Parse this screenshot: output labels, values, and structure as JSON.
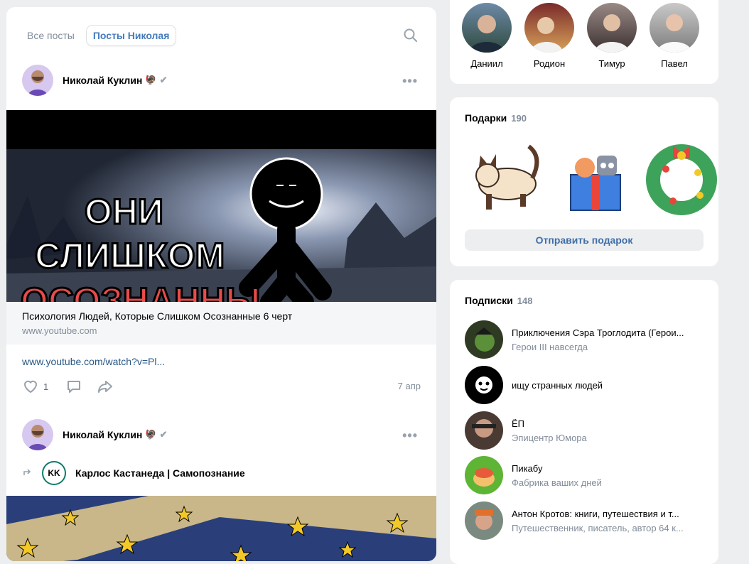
{
  "feed": {
    "tabs": [
      {
        "label": "Все посты"
      },
      {
        "label": "Посты Николая"
      }
    ],
    "posts": [
      {
        "author": "Николай Куклин",
        "emoji": "🦃",
        "link_title": "Психология Людей, Которые Слишком Осознанные 6 черт",
        "link_domain": "www.youtube.com",
        "url_text": "www.youtube.com/watch?v=Pl...",
        "likes": "1",
        "date": "7 апр",
        "thumb_text": [
          "ОНИ",
          "СЛИШКОМ",
          "ОСОЗНАННЫ"
        ]
      },
      {
        "author": "Николай Куклин",
        "emoji": "🦃",
        "repost_group": "Карлос Кастанеда | Самопознание",
        "repost_logo": "KK"
      }
    ]
  },
  "friends": [
    {
      "name": "Даниил"
    },
    {
      "name": "Родион"
    },
    {
      "name": "Тимур"
    },
    {
      "name": "Павел"
    }
  ],
  "gifts": {
    "title": "Подарки",
    "count": "190",
    "send_label": "Отправить подарок"
  },
  "subscriptions": {
    "title": "Подписки",
    "count": "148",
    "items": [
      {
        "name": "Приключения Сэра Троглодита (Герои...",
        "sub": "Герои III навсегда"
      },
      {
        "name": "ищу странных людей",
        "sub": ""
      },
      {
        "name": "ЁП",
        "sub": "Эпицентр Юмора"
      },
      {
        "name": "Пикабу",
        "sub": "Фабрика ваших дней"
      },
      {
        "name": "Антон Кротов: книги, путешествия и т...",
        "sub": "Путешественник, писатель, автор 64 к..."
      }
    ]
  },
  "colors": {
    "accent": "#2a5885",
    "bg": "#edeef0",
    "muted": "#818c99"
  }
}
